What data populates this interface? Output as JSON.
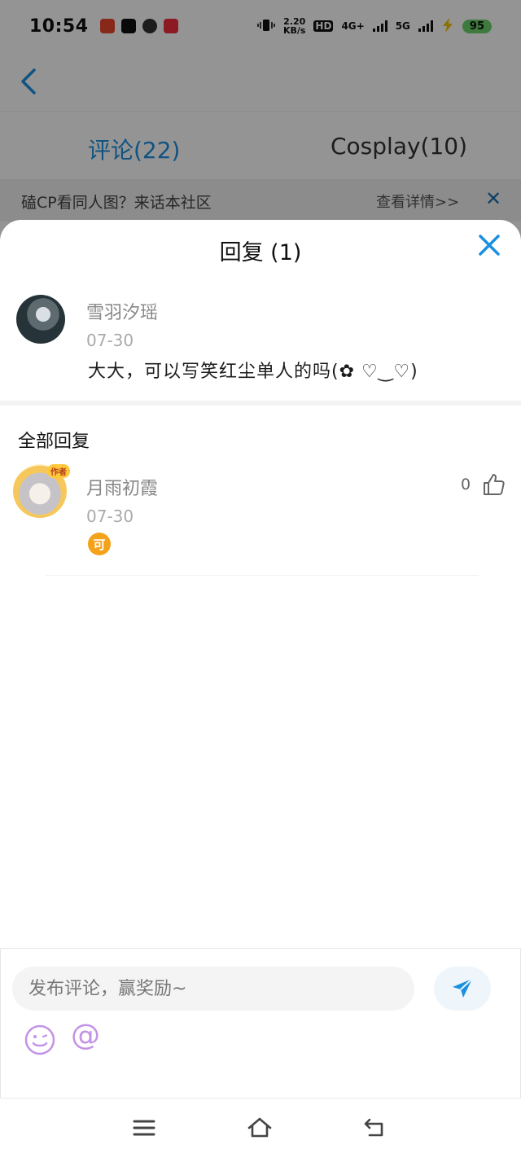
{
  "status_bar": {
    "time": "10:54",
    "net_speed_value": "2.20",
    "net_speed_unit": "KB/s",
    "hd_label": "HD",
    "signal_1": "4G+",
    "signal_2": "5G",
    "battery": "95"
  },
  "tabs": [
    {
      "label": "评论(22)",
      "active": true
    },
    {
      "label": "Cosplay(10)",
      "active": false
    }
  ],
  "banner": {
    "text": "磕CP看同人图？来话本社区",
    "detail_link": "查看详情>>",
    "close_icon": "close-icon"
  },
  "sheet": {
    "title": "回复 (1)",
    "close_icon": "close-icon",
    "original_comment": {
      "username": "雪羽汐瑶",
      "date": "07-30",
      "content": "大大，可以写笑红尘单人的吗(✿ ♡‿♡)"
    },
    "section_title": "全部回复",
    "replies": [
      {
        "username": "月雨初霞",
        "badge": "作者",
        "date": "07-30",
        "emoji_text": "可",
        "like_count": "0"
      }
    ]
  },
  "input": {
    "placeholder": "发布评论，赢奖励~",
    "send_icon": "send-icon",
    "emoji_icon": "smiley-icon",
    "at_symbol": "@"
  },
  "colors": {
    "accent": "#1a8fe0",
    "emoji_purple": "#c393e6",
    "overlay": "rgba(0,0,0,0.42)"
  }
}
